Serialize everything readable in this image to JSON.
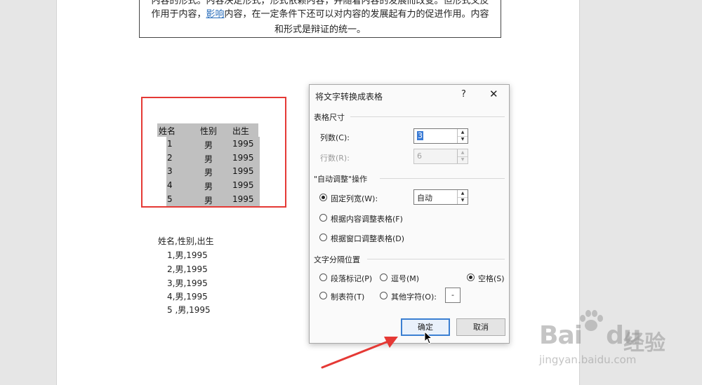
{
  "document": {
    "top_text": {
      "line1": "内容的形式。内容决定形式，形式依赖内容，并随着内容的发展而改变。但形式又反",
      "line2_pre": "作用于内容，",
      "line2_link": "影响",
      "line2_post": "内容，在一定条件下还可以对内容的发展起有力的促进作用。内容",
      "line3": "和形式是辩证的统一。"
    },
    "selected_table": {
      "headers": [
        "姓名",
        "性别",
        "出生"
      ],
      "rows": [
        [
          "1",
          "男",
          "1995"
        ],
        [
          "2",
          "男",
          "1995"
        ],
        [
          "3",
          "男",
          "1995"
        ],
        [
          "4",
          "男",
          "1995"
        ],
        [
          "5",
          "男",
          "1995"
        ]
      ]
    },
    "comma_text": [
      "姓名,性别,出生",
      "1,男,1995",
      "2,男,1995",
      "3,男,1995",
      "4,男,1995",
      "5 ,男,1995"
    ]
  },
  "dialog": {
    "title": "将文字转换成表格",
    "help": "?",
    "close": "✕",
    "size_section": "表格尺寸",
    "columns_label": "列数(C):",
    "columns_value": "3",
    "rows_label": "行数(R):",
    "rows_value": "6",
    "autofit_section": "\"自动调整\"操作",
    "fixed_width_label": "固定列宽(W):",
    "fixed_width_value": "自动",
    "fit_content_label": "根据内容调整表格(F)",
    "fit_window_label": "根据窗口调整表格(D)",
    "separator_section": "文字分隔位置",
    "sep_paragraph": "段落标记(P)",
    "sep_comma": "逗号(M)",
    "sep_space": "空格(S)",
    "sep_tab": "制表符(T)",
    "sep_other": "其他字符(O):",
    "sep_other_value": "-",
    "ok": "确定",
    "cancel": "取消"
  },
  "watermark": {
    "logo": "Bai",
    "logo_tail": "du",
    "cn": "经验",
    "url": "jingyan.baidu.com"
  },
  "colors": {
    "highlight_box": "#e53935",
    "selection": "#c0c0c0",
    "primary_button_border": "#3b7fd2"
  }
}
